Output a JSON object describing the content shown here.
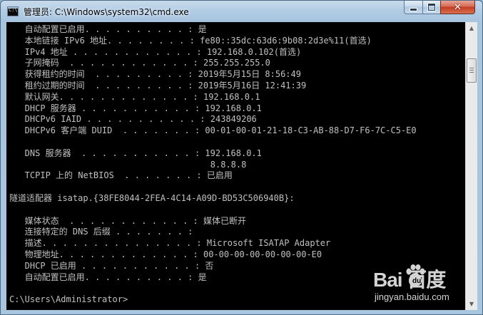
{
  "window": {
    "title": "管理员: C:\\Windows\\system32\\cmd.exe",
    "close_glyph": "✕"
  },
  "console": {
    "lines": [
      "   自动配置已启用. . . . . . . . . . : 是",
      "   本地链接 IPv6 地址. . . . . . . . : fe80::35dc:63d6:9b08:2d3e%11(首选)",
      "   IPv4 地址 . . . . . . . . . . . . : 192.168.0.102(首选)",
      "   子网掩码  . . . . . . . . . . . . : 255.255.255.0",
      "   获得租约的时间  . . . . . . . . . : 2019年5月15日 8:56:49",
      "   租约过期的时间  . . . . . . . . . : 2019年5月16日 12:41:39",
      "   默认网关. . . . . . . . . . . . . : 192.168.0.1",
      "   DHCP 服务器 . . . . . . . . . . . : 192.168.0.1",
      "   DHCPv6 IAID . . . . . . . . . . . : 243849206",
      "   DHCPv6 客户端 DUID  . . . . . . . : 00-01-00-01-21-18-C3-AB-88-D7-F6-7C-C5-E0",
      "",
      "   DNS 服务器  . . . . . . . . . . . : 192.168.0.1",
      "                                       8.8.8.8",
      "   TCPIP 上的 NetBIOS  . . . . . . . : 已启用",
      "",
      "隧道适配器 isatap.{38FE8044-2FEA-4C14-A09D-BD53C506940B}:",
      "",
      "   媒体状态  . . . . . . . . . . . . : 媒体已断开",
      "   连接特定的 DNS 后缀 . . . . . . . :",
      "   描述. . . . . . . . . . . . . . . : Microsoft ISATAP Adapter",
      "   物理地址. . . . . . . . . . . . . : 00-00-00-00-00-00-00-E0",
      "   DHCP 已启用 . . . . . . . . . . . : 否",
      "   自动配置已启用. . . . . . . . . . : 是",
      "",
      "C:\\Users\\Administrator>"
    ]
  },
  "scrollbar": {
    "up_arrow": "▲",
    "down_arrow": "▼",
    "position_fraction": 0.1
  },
  "watermark": {
    "logo_text": "Bai  百度",
    "url_text": "jingyan.baidu.com"
  },
  "icons": {
    "app": "cmd-icon",
    "minimize": "minimize-icon",
    "maximize": "maximize-icon",
    "close": "close-icon"
  },
  "colors": {
    "console_bg": "#000000",
    "console_fg": "#c0c0c0",
    "titlebar": "#b2cce4",
    "close_button": "#c33c22"
  }
}
